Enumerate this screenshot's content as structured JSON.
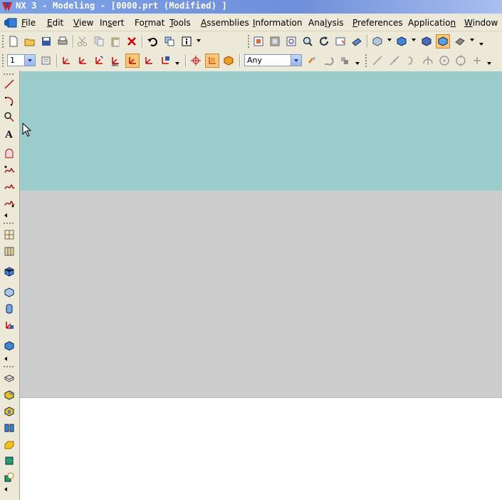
{
  "window": {
    "title": "NX 3 - Modeling - [0000.prt (Modified) ]"
  },
  "menubar": {
    "items": [
      {
        "label": "File",
        "underline": "F"
      },
      {
        "label": "Edit",
        "underline": "E"
      },
      {
        "label": "View",
        "underline": "V"
      },
      {
        "label": "Insert",
        "underline": "s"
      },
      {
        "label": "Format",
        "underline": "r"
      },
      {
        "label": "Tools",
        "underline": "T"
      },
      {
        "label": "Assemblies",
        "underline": "A"
      },
      {
        "label": "Information",
        "underline": "I"
      },
      {
        "label": "Analysis",
        "underline": "l"
      },
      {
        "label": "Preferences",
        "underline": "P"
      },
      {
        "label": "Application",
        "underline": "n"
      },
      {
        "label": "Window",
        "underline": "W"
      }
    ]
  },
  "toolbar2": {
    "layer_value": "1",
    "filter_value": "Any"
  },
  "colors": {
    "teal": "#9bcccc",
    "gray": "#cccccc",
    "white": "#ffffff",
    "title_blue": "#7fa2e6",
    "active_button": "#f7c87a"
  }
}
